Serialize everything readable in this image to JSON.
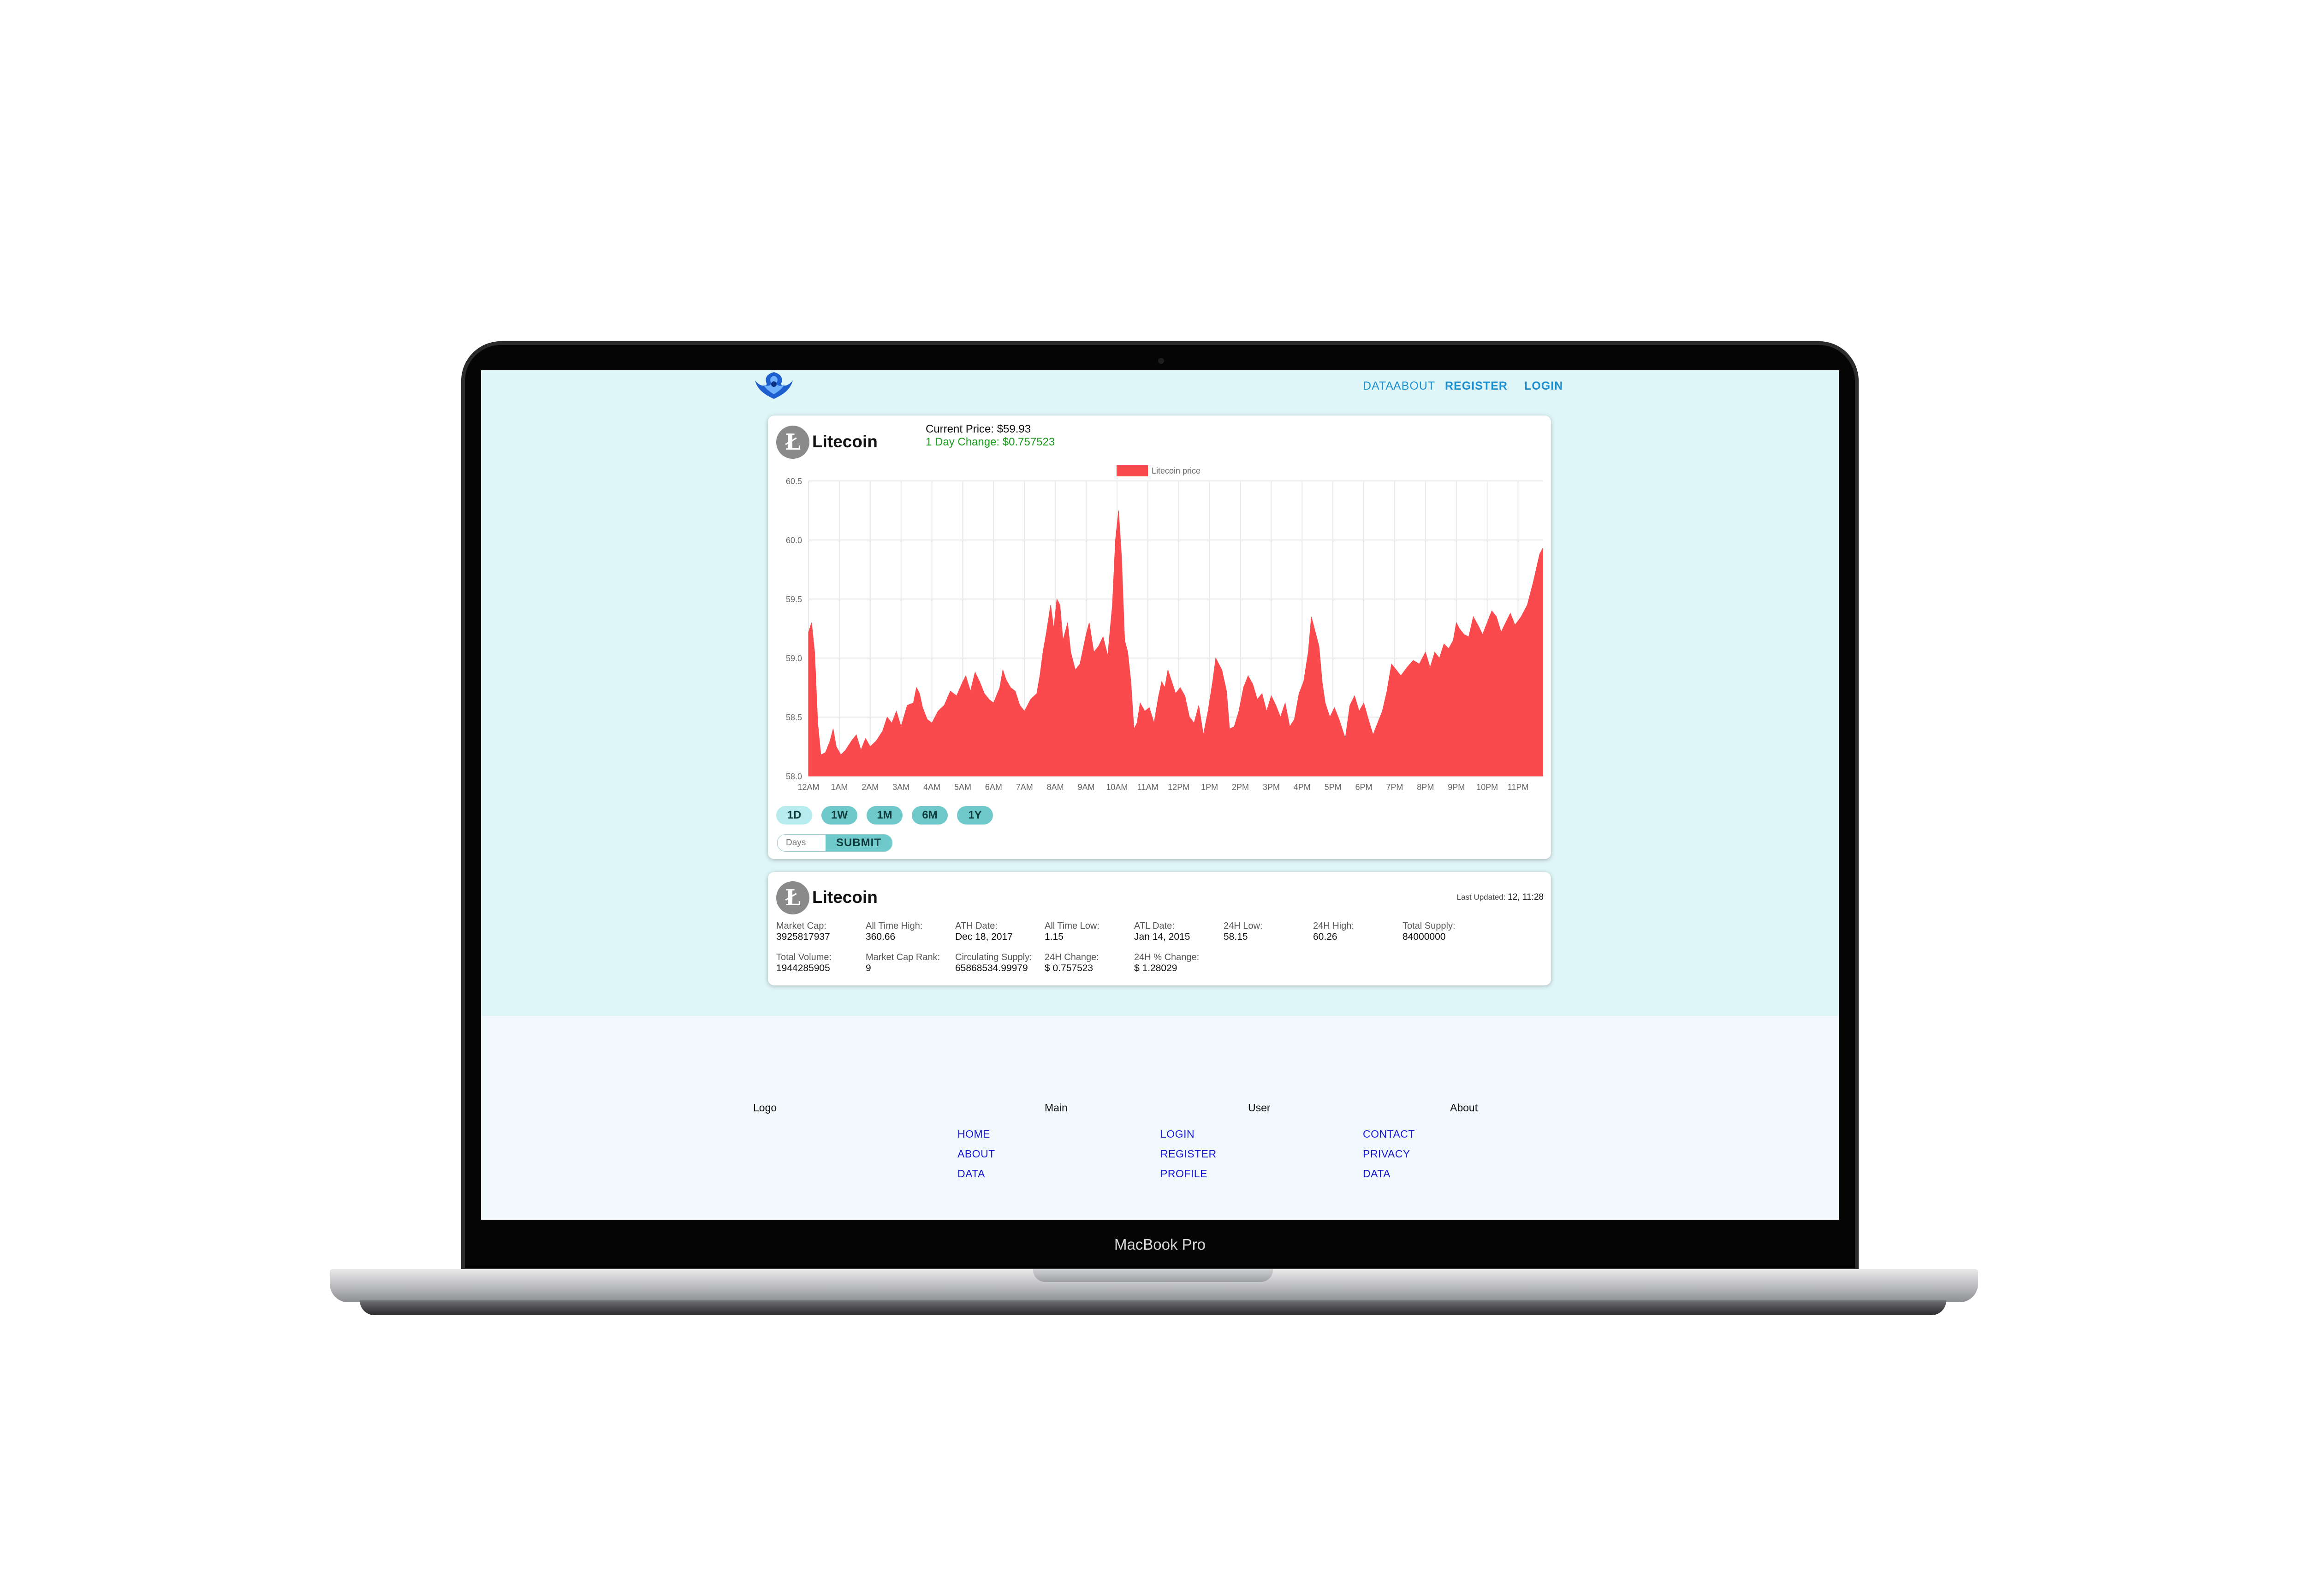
{
  "device": {
    "label": "MacBook Pro"
  },
  "nav": {
    "data": "DATA",
    "about": "ABOUT",
    "register": "REGISTER",
    "login": "LOGIN"
  },
  "price_card": {
    "coin_name": "Litecoin",
    "coin_symbol": "Ł",
    "current_price": "Current Price: $59.93",
    "day_change": "1 Day Change: $0.757523",
    "range_buttons": [
      "1D",
      "1W",
      "1M",
      "6M",
      "1Y"
    ],
    "active_range": "1D",
    "days_placeholder": "Days",
    "submit_label": "SUBMIT"
  },
  "chart_data": {
    "type": "area",
    "legend": "Litecoin price",
    "legend_position": "top-center",
    "color": "#fa4a4d",
    "grid": true,
    "ylim": [
      58.0,
      60.5
    ],
    "y_ticks": [
      "60.5",
      "60.0",
      "59.5",
      "59.0",
      "58.5",
      "58.0"
    ],
    "x_ticks": [
      "12AM",
      "1AM",
      "2AM",
      "3AM",
      "4AM",
      "5AM",
      "6AM",
      "7AM",
      "8AM",
      "9AM",
      "10AM",
      "11AM",
      "12PM",
      "1PM",
      "2PM",
      "3PM",
      "4PM",
      "5PM",
      "6PM",
      "7PM",
      "8PM",
      "9PM",
      "10PM",
      "11PM"
    ],
    "x_range_hours": [
      0,
      23.8
    ],
    "series": [
      {
        "name": "Litecoin price",
        "points": [
          [
            0.0,
            59.22
          ],
          [
            0.1,
            59.3
          ],
          [
            0.2,
            59.05
          ],
          [
            0.3,
            58.45
          ],
          [
            0.4,
            58.18
          ],
          [
            0.55,
            58.2
          ],
          [
            0.7,
            58.3
          ],
          [
            0.8,
            58.4
          ],
          [
            0.9,
            58.25
          ],
          [
            1.05,
            58.18
          ],
          [
            1.2,
            58.22
          ],
          [
            1.4,
            58.3
          ],
          [
            1.55,
            58.35
          ],
          [
            1.7,
            58.22
          ],
          [
            1.85,
            58.32
          ],
          [
            2.0,
            58.25
          ],
          [
            2.2,
            58.3
          ],
          [
            2.4,
            58.38
          ],
          [
            2.55,
            58.5
          ],
          [
            2.7,
            58.45
          ],
          [
            2.85,
            58.55
          ],
          [
            3.0,
            58.42
          ],
          [
            3.2,
            58.6
          ],
          [
            3.4,
            58.62
          ],
          [
            3.5,
            58.75
          ],
          [
            3.6,
            58.7
          ],
          [
            3.7,
            58.58
          ],
          [
            3.85,
            58.48
          ],
          [
            4.0,
            58.45
          ],
          [
            4.2,
            58.55
          ],
          [
            4.4,
            58.6
          ],
          [
            4.6,
            58.72
          ],
          [
            4.8,
            58.68
          ],
          [
            5.0,
            58.8
          ],
          [
            5.1,
            58.85
          ],
          [
            5.25,
            58.72
          ],
          [
            5.4,
            58.88
          ],
          [
            5.55,
            58.8
          ],
          [
            5.7,
            58.7
          ],
          [
            5.85,
            58.65
          ],
          [
            6.0,
            58.62
          ],
          [
            6.2,
            58.75
          ],
          [
            6.3,
            58.9
          ],
          [
            6.4,
            58.82
          ],
          [
            6.55,
            58.75
          ],
          [
            6.7,
            58.72
          ],
          [
            6.85,
            58.6
          ],
          [
            7.0,
            58.55
          ],
          [
            7.2,
            58.65
          ],
          [
            7.4,
            58.7
          ],
          [
            7.5,
            58.85
          ],
          [
            7.6,
            59.05
          ],
          [
            7.7,
            59.2
          ],
          [
            7.85,
            59.45
          ],
          [
            7.95,
            59.25
          ],
          [
            8.05,
            59.5
          ],
          [
            8.15,
            59.45
          ],
          [
            8.25,
            59.15
          ],
          [
            8.4,
            59.3
          ],
          [
            8.5,
            59.05
          ],
          [
            8.65,
            58.9
          ],
          [
            8.8,
            58.95
          ],
          [
            9.0,
            59.2
          ],
          [
            9.1,
            59.3
          ],
          [
            9.25,
            59.05
          ],
          [
            9.4,
            59.1
          ],
          [
            9.55,
            59.18
          ],
          [
            9.7,
            59.02
          ],
          [
            9.85,
            59.45
          ],
          [
            9.95,
            60.0
          ],
          [
            10.05,
            60.25
          ],
          [
            10.15,
            59.85
          ],
          [
            10.25,
            59.15
          ],
          [
            10.35,
            59.05
          ],
          [
            10.45,
            58.8
          ],
          [
            10.55,
            58.4
          ],
          [
            10.65,
            58.45
          ],
          [
            10.75,
            58.62
          ],
          [
            10.9,
            58.55
          ],
          [
            11.05,
            58.58
          ],
          [
            11.2,
            58.45
          ],
          [
            11.35,
            58.68
          ],
          [
            11.45,
            58.8
          ],
          [
            11.55,
            58.75
          ],
          [
            11.65,
            58.9
          ],
          [
            11.75,
            58.82
          ],
          [
            11.9,
            58.7
          ],
          [
            12.05,
            58.75
          ],
          [
            12.2,
            58.68
          ],
          [
            12.35,
            58.5
          ],
          [
            12.5,
            58.45
          ],
          [
            12.65,
            58.6
          ],
          [
            12.8,
            58.35
          ],
          [
            12.95,
            58.55
          ],
          [
            13.1,
            58.8
          ],
          [
            13.2,
            59.0
          ],
          [
            13.3,
            58.95
          ],
          [
            13.4,
            58.9
          ],
          [
            13.55,
            58.72
          ],
          [
            13.65,
            58.4
          ],
          [
            13.8,
            58.42
          ],
          [
            13.95,
            58.55
          ],
          [
            14.1,
            58.75
          ],
          [
            14.25,
            58.85
          ],
          [
            14.4,
            58.78
          ],
          [
            14.55,
            58.65
          ],
          [
            14.7,
            58.7
          ],
          [
            14.85,
            58.55
          ],
          [
            15.0,
            58.68
          ],
          [
            15.15,
            58.6
          ],
          [
            15.3,
            58.5
          ],
          [
            15.45,
            58.62
          ],
          [
            15.6,
            58.42
          ],
          [
            15.75,
            58.48
          ],
          [
            15.9,
            58.7
          ],
          [
            16.05,
            58.8
          ],
          [
            16.2,
            59.05
          ],
          [
            16.3,
            59.35
          ],
          [
            16.4,
            59.25
          ],
          [
            16.55,
            59.1
          ],
          [
            16.65,
            58.8
          ],
          [
            16.75,
            58.62
          ],
          [
            16.9,
            58.5
          ],
          [
            17.05,
            58.58
          ],
          [
            17.2,
            58.48
          ],
          [
            17.4,
            58.32
          ],
          [
            17.55,
            58.6
          ],
          [
            17.7,
            58.68
          ],
          [
            17.85,
            58.55
          ],
          [
            18.0,
            58.62
          ],
          [
            18.15,
            58.48
          ],
          [
            18.3,
            58.35
          ],
          [
            18.45,
            58.45
          ],
          [
            18.6,
            58.55
          ],
          [
            18.75,
            58.72
          ],
          [
            18.9,
            58.95
          ],
          [
            19.05,
            58.9
          ],
          [
            19.2,
            58.85
          ],
          [
            19.4,
            58.92
          ],
          [
            19.6,
            58.98
          ],
          [
            19.8,
            58.95
          ],
          [
            20.0,
            59.05
          ],
          [
            20.15,
            58.92
          ],
          [
            20.3,
            59.05
          ],
          [
            20.45,
            59.0
          ],
          [
            20.6,
            59.12
          ],
          [
            20.75,
            59.08
          ],
          [
            20.9,
            59.15
          ],
          [
            21.0,
            59.3
          ],
          [
            21.1,
            59.25
          ],
          [
            21.25,
            59.2
          ],
          [
            21.4,
            59.18
          ],
          [
            21.55,
            59.35
          ],
          [
            21.7,
            59.28
          ],
          [
            21.85,
            59.2
          ],
          [
            22.0,
            59.3
          ],
          [
            22.15,
            59.4
          ],
          [
            22.3,
            59.35
          ],
          [
            22.45,
            59.22
          ],
          [
            22.6,
            59.3
          ],
          [
            22.75,
            59.38
          ],
          [
            22.9,
            59.28
          ],
          [
            23.1,
            59.35
          ],
          [
            23.3,
            59.45
          ],
          [
            23.5,
            59.65
          ],
          [
            23.7,
            59.88
          ],
          [
            23.8,
            59.93
          ]
        ]
      }
    ]
  },
  "stats_card": {
    "coin_name": "Litecoin",
    "coin_symbol": "Ł",
    "last_updated_label": "Last Updated:",
    "last_updated_value": "12, 11:28",
    "row1": [
      {
        "label": "Market Cap:",
        "value": "3925817937"
      },
      {
        "label": "All Time High:",
        "value": "360.66"
      },
      {
        "label": "ATH Date:",
        "value": "Dec 18, 2017"
      },
      {
        "label": "All Time Low:",
        "value": "1.15"
      },
      {
        "label": "ATL Date:",
        "value": "Jan 14, 2015"
      },
      {
        "label": "24H Low:",
        "value": "58.15"
      },
      {
        "label": "24H High:",
        "value": "60.26"
      },
      {
        "label": "Total Supply:",
        "value": "84000000"
      }
    ],
    "row2": [
      {
        "label": "Total Volume:",
        "value": "1944285905"
      },
      {
        "label": "Market Cap Rank:",
        "value": "9"
      },
      {
        "label": "Circulating Supply:",
        "value": "65868534.99979"
      },
      {
        "label": "24H Change:",
        "value": "$ 0.757523"
      },
      {
        "label": "24H % Change:",
        "value": "$ 1.28029"
      }
    ]
  },
  "footer": {
    "headings": [
      "Logo",
      "Main",
      "User",
      "About"
    ],
    "main_links": [
      "HOME",
      "ABOUT",
      "DATA"
    ],
    "user_links": [
      "LOGIN",
      "REGISTER",
      "PROFILE"
    ],
    "about_links": [
      "CONTACT",
      "PRIVACY",
      "DATA"
    ]
  }
}
